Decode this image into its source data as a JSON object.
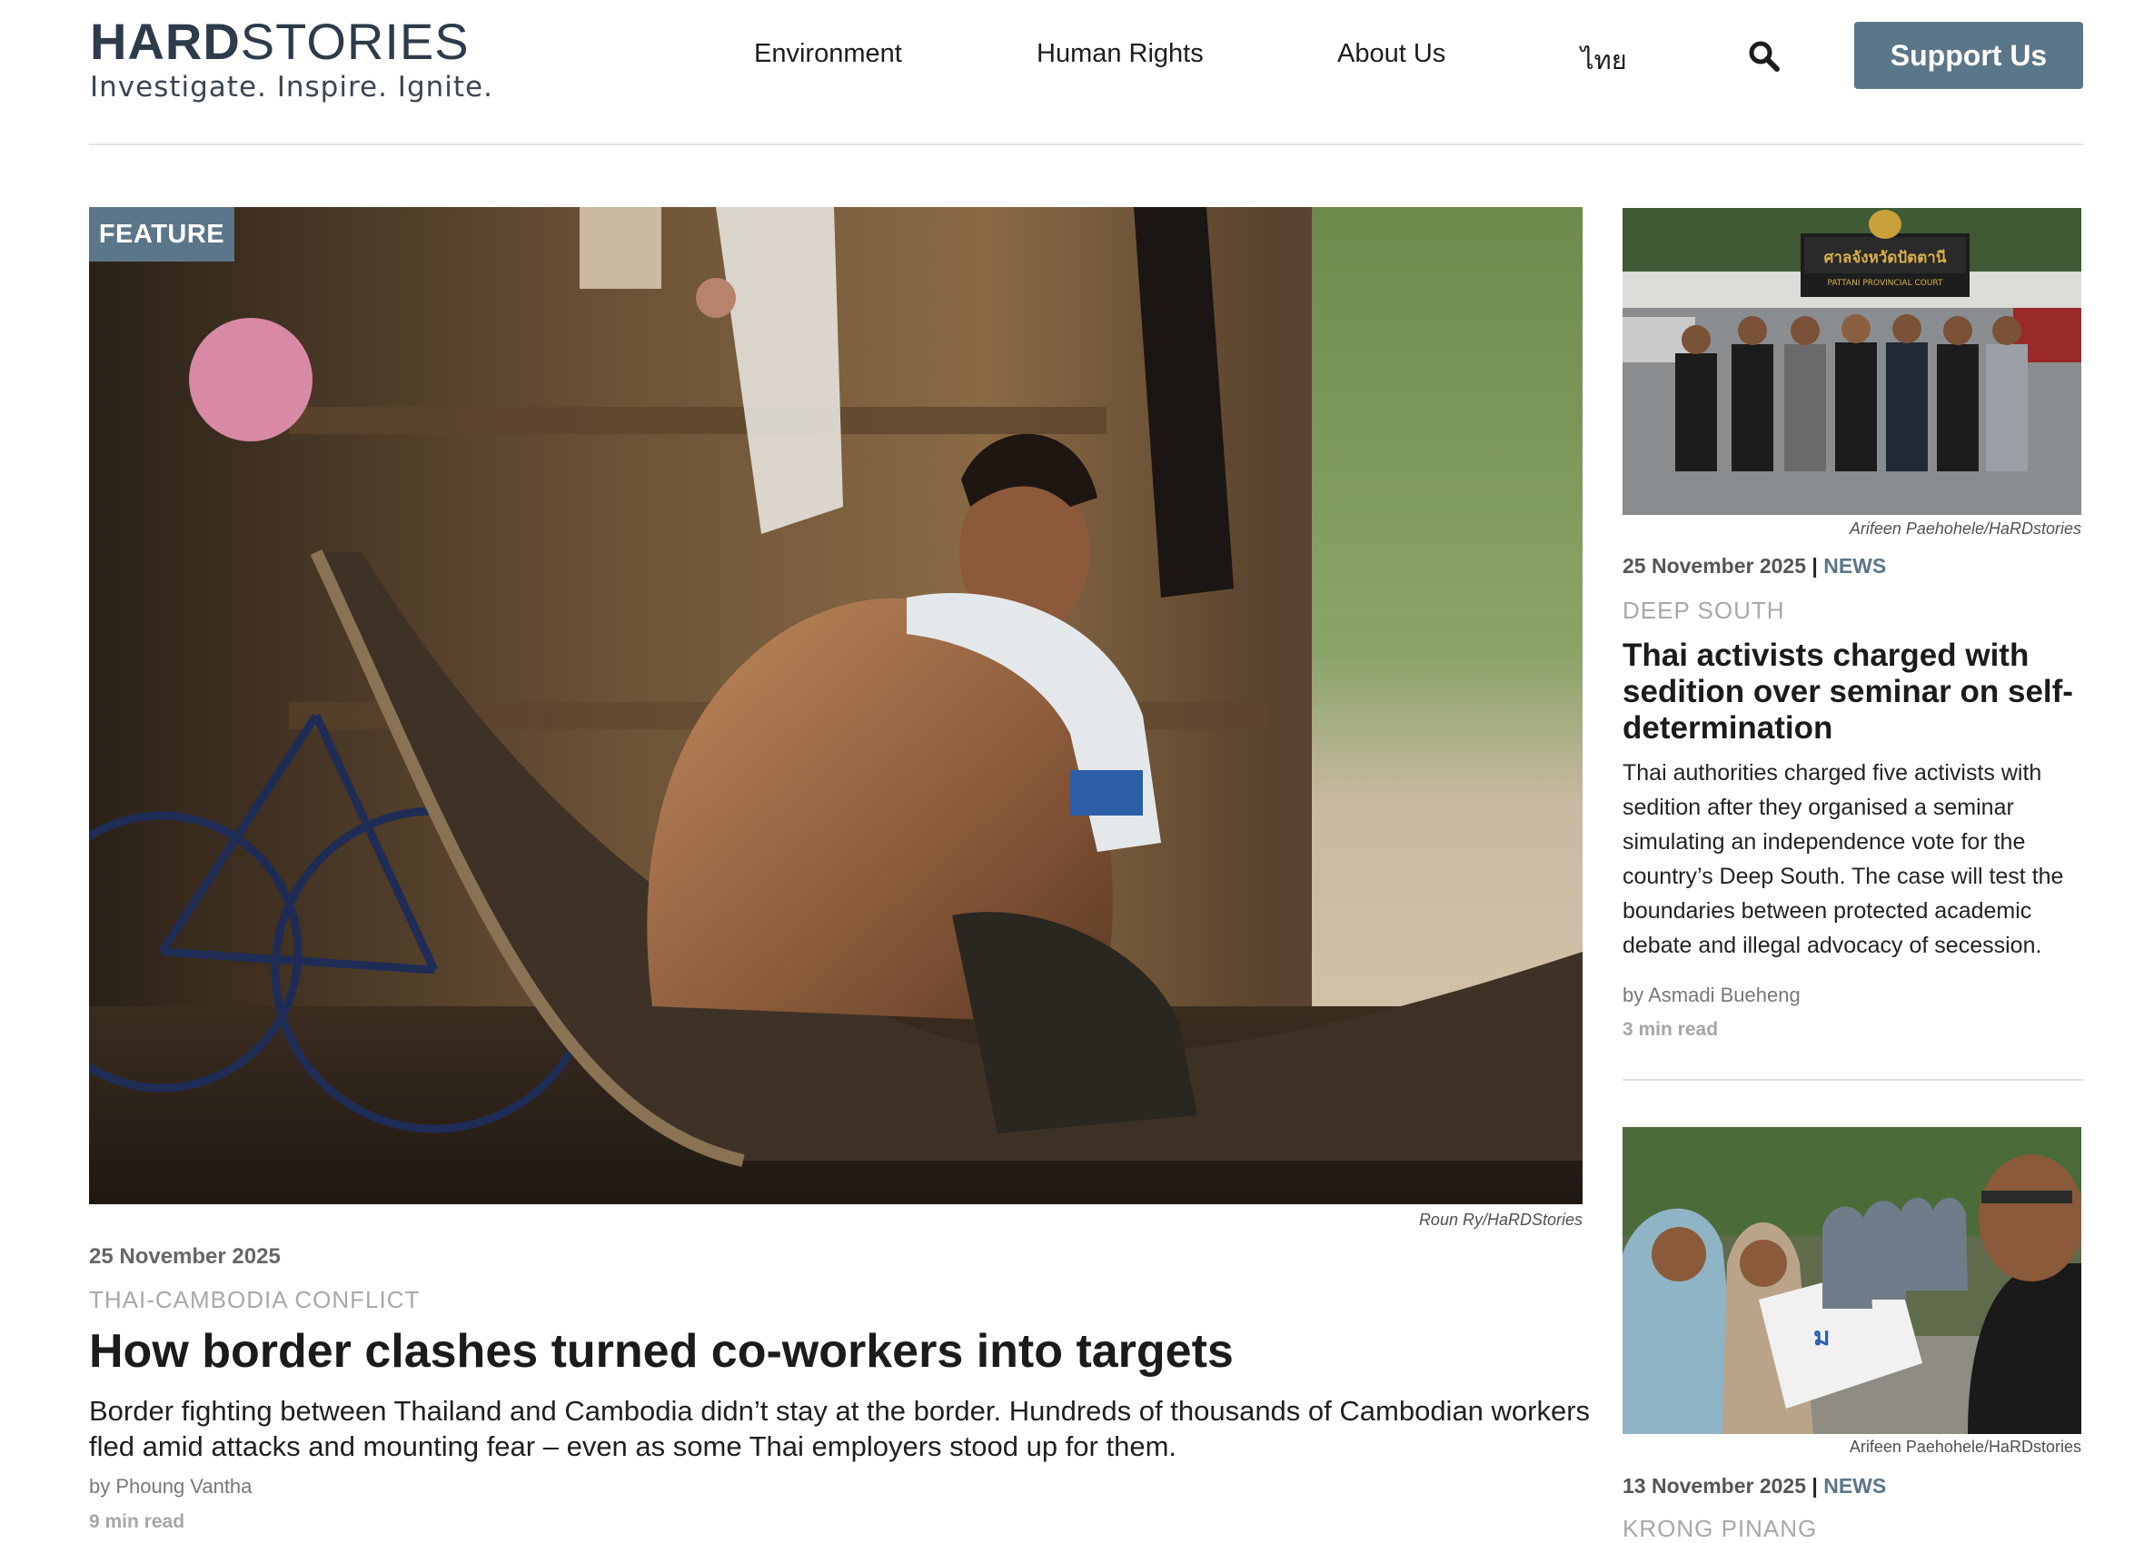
{
  "brand": {
    "logo_bold": "HARD",
    "logo_light": "STORIES",
    "tagline": "Investigate. Inspire. Ignite."
  },
  "nav": {
    "items": [
      "Environment",
      "Human Rights",
      "About Us",
      "ไทย"
    ],
    "search_icon": "search-icon",
    "support_label": "Support Us",
    "support_color": "#5b7688"
  },
  "feature": {
    "badge": "FEATURE",
    "image_credit": "Roun Ry/HaRDStories",
    "date": "25 November 2025",
    "category": "THAI-CAMBODIA CONFLICT",
    "title": "How border clashes turned co-workers into targets",
    "excerpt": "Border fighting between Thailand and Cambodia didn’t stay at the border. Hundreds of thousands of Cambodian workers fled amid attacks and mounting fear – even as some Thai employers stood up for them.",
    "author": "by Phoung Vantha",
    "read_time": "9 min read"
  },
  "sidebar": {
    "articles": [
      {
        "image_credit": "Arifeen Paehohele/HaRDstories",
        "date": "25 November 2025",
        "separator": "|",
        "type": "NEWS",
        "category": "DEEP SOUTH",
        "title": "Thai activists charged with sedition over seminar on self-determination",
        "excerpt": "Thai authorities charged five activists with sedition after they organised a seminar simulating an independence vote for the country’s Deep South. The case will test the boundaries between protected academic debate and illegal advocacy of secession.",
        "author": "by Asmadi Bueheng",
        "read_time": "3 min read",
        "sign_text": "ศาลจังหวัดปัตตานี",
        "sign_subtext": "PATTANI PROVINCIAL COURT"
      },
      {
        "image_credit": "Arifeen Paehohele/HaRDstories",
        "date": "13 November 2025",
        "separator": "|",
        "type": "NEWS",
        "category": "KRONG PINANG"
      }
    ]
  }
}
